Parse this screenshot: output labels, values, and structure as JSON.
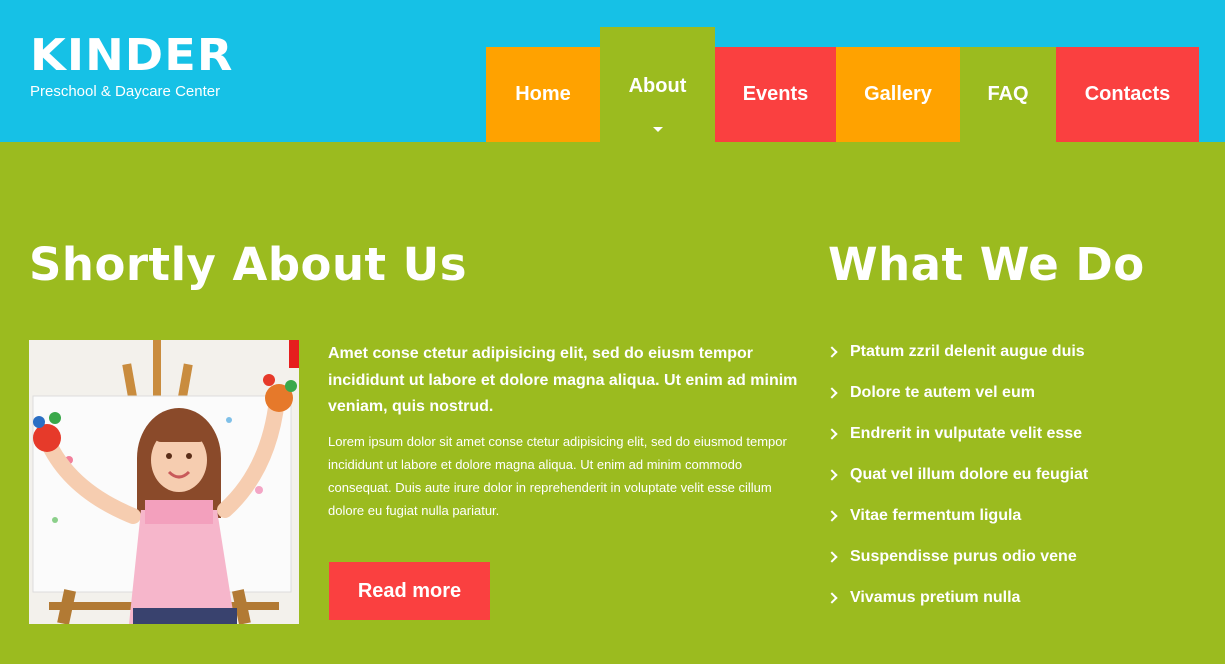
{
  "brand": {
    "title": "KINDER",
    "subtitle": "Preschool & Daycare Center"
  },
  "nav": {
    "items": [
      {
        "label": "Home",
        "color": "#ffa200"
      },
      {
        "label": "About",
        "color": "#9bbb1f",
        "active": true
      },
      {
        "label": "Events",
        "color": "#fa4040"
      },
      {
        "label": "Gallery",
        "color": "#ffa200"
      },
      {
        "label": "FAQ",
        "color": "#9bbb1f"
      },
      {
        "label": "Contacts",
        "color": "#fa4040"
      }
    ]
  },
  "about": {
    "title": "Shortly About Us",
    "lead": "Amet conse ctetur adipisicing elit, sed do eiusm tempor incididunt ut labore et dolore magna aliqua. Ut enim ad minim veniam, quis nostrud.",
    "body": "Lorem ipsum dolor sit amet conse ctetur adipisicing elit, sed do eiusmod tempor incididunt ut labore et dolore magna aliqua. Ut enim ad minim commodo consequat. Duis aute irure dolor in reprehenderit in voluptate velit esse cillum dolore eu fugiat nulla pariatur.",
    "button": "Read more"
  },
  "what_we_do": {
    "title": "What We Do",
    "items": [
      "Ptatum zzril delenit augue duis",
      "Dolore te autem vel eum",
      "Endrerit in vulputate velit esse",
      "Quat vel illum dolore eu feugiat",
      "Vitae fermentum ligula",
      "Suspendisse purus odio vene",
      "Vivamus pretium nulla"
    ]
  },
  "colors": {
    "header_bg": "#16c1e6",
    "page_bg": "#9bbb1f",
    "orange": "#ffa200",
    "red": "#fa4040"
  }
}
